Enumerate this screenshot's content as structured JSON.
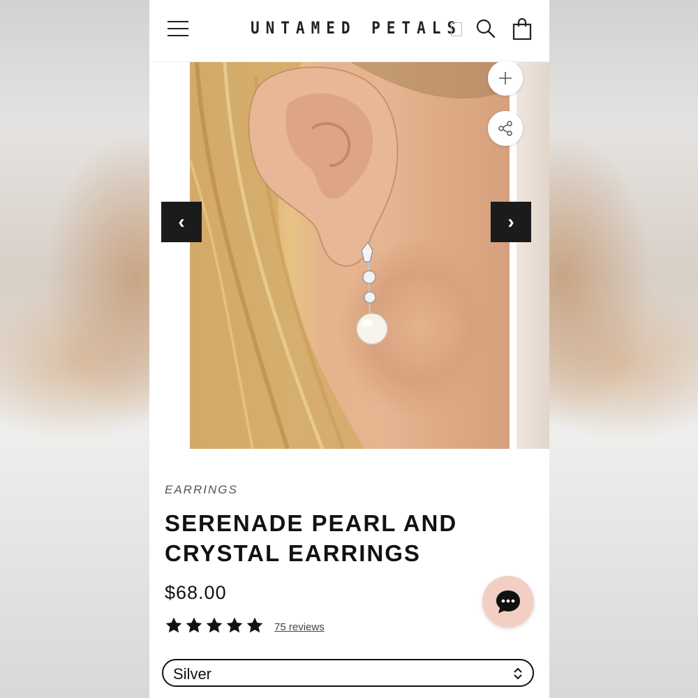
{
  "header": {
    "brand": "UNTAMED PETALS",
    "menu_icon": "hamburger-menu-icon",
    "search_icon": "search-icon",
    "cart_icon": "shopping-bag-icon"
  },
  "gallery": {
    "prev_arrow": "‹",
    "next_arrow": "›",
    "zoom_icon": "plus-icon",
    "share_icon": "share-icon"
  },
  "product": {
    "category": "EARRINGS",
    "title": "SERENADE PEARL AND CRYSTAL EARRINGS",
    "price": "$68.00",
    "rating": 5,
    "rating_max": 5,
    "reviews_label": "75 reviews"
  },
  "variant_select": {
    "selected": "Silver"
  },
  "colors": {
    "text": "#111111",
    "chat_bubble": "#f2cfc2",
    "arrow_bg": "#1b1b1b"
  }
}
